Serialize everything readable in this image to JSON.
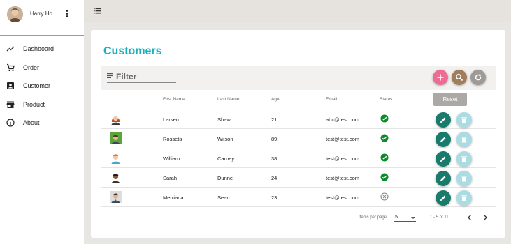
{
  "sidebar": {
    "user_name": "Harry Ho",
    "nav": [
      {
        "label": "Dashboard",
        "icon": "trending-icon"
      },
      {
        "label": "Order",
        "icon": "cart-icon"
      },
      {
        "label": "Customer",
        "icon": "contact-icon"
      },
      {
        "label": "Product",
        "icon": "store-icon"
      },
      {
        "label": "About",
        "icon": "info-icon"
      }
    ]
  },
  "main": {
    "title": "Customers",
    "filter_label": "Filter",
    "reset_label": "Reset",
    "columns": [
      "First Name",
      "Last Name",
      "Age",
      "Email",
      "Status"
    ],
    "rows": [
      {
        "first": "Larsen",
        "last": "Shaw",
        "age": "21",
        "email": "abc@test.com",
        "status": "active",
        "avatar": "woman-red-hair"
      },
      {
        "first": "Rosseta",
        "last": "Wilson",
        "age": "89",
        "email": "test@test.com",
        "status": "active",
        "avatar": "man-green-bg"
      },
      {
        "first": "William",
        "last": "Carney",
        "age": "38",
        "email": "test@test.com",
        "status": "active",
        "avatar": "man-light"
      },
      {
        "first": "Sarah",
        "last": "Dunne",
        "age": "24",
        "email": "test@test.com",
        "status": "active",
        "avatar": "man-dark-hair"
      },
      {
        "first": "Merriana",
        "last": "Sean",
        "age": "23",
        "email": "test@test.com",
        "status": "inactive",
        "avatar": "man-suit"
      }
    ],
    "pager": {
      "items_label": "Items per page:",
      "page_size": "5",
      "range": "1 - 5 of 11"
    }
  },
  "colors": {
    "title": "#14b1bf",
    "add_fab": "#f06b94",
    "search_fab": "#a17c5d",
    "refresh_fab": "#9e9a96",
    "edit_button": "#1a7b6c",
    "delete_button": "#a9dde3",
    "status_active": "#0a8a2a"
  }
}
